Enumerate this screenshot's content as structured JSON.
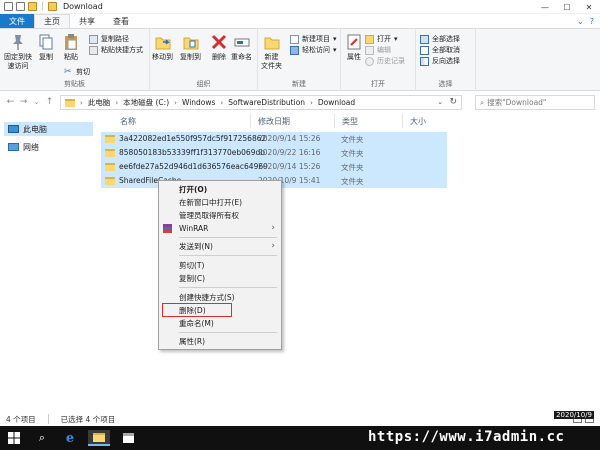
{
  "window": {
    "title": "Download",
    "controls": {
      "minimize": "—",
      "maximize": "☐",
      "close": "✕"
    }
  },
  "tabs": {
    "file": "文件",
    "home": "主页",
    "share": "共享",
    "view": "查看"
  },
  "ribbon": {
    "clipboard": {
      "label": "剪贴板",
      "pin": "固定到快\n速访问",
      "copy": "复制",
      "paste": "粘贴",
      "copy_path": "复制路径",
      "paste_shortcut": "粘贴快捷方式",
      "cut": "剪切"
    },
    "organize": {
      "label": "组织",
      "move_to": "移动到",
      "copy_to": "复制到",
      "delete": "删除",
      "rename": "重命名"
    },
    "new": {
      "label": "新建",
      "new_folder": "新建\n文件夹",
      "new_item": "新建项目",
      "easy_access": "轻松访问"
    },
    "open": {
      "label": "打开",
      "properties": "属性",
      "open": "打开",
      "edit": "编辑",
      "history": "历史记录"
    },
    "select": {
      "label": "选择",
      "select_all": "全部选择",
      "select_none": "全部取消",
      "invert": "反向选择"
    }
  },
  "address": {
    "crumbs": [
      "此电脑",
      "本地磁盘 (C:)",
      "Windows",
      "SoftwareDistribution",
      "Download"
    ],
    "search_placeholder": "搜索\"Download\""
  },
  "nav": {
    "this_pc": "此电脑",
    "network": "网络"
  },
  "columns": {
    "name": "名称",
    "date": "修改日期",
    "type": "类型",
    "size": "大小"
  },
  "files": [
    {
      "name": "3a422082ed1e550f957dc5f917256862",
      "date": "2020/9/14 15:26",
      "type": "文件夹"
    },
    {
      "name": "858050183b53339ff1f313770eb069db",
      "date": "2020/9/22 16:16",
      "type": "文件夹"
    },
    {
      "name": "ee6fde27a52d946d1d636576eac64969",
      "date": "2020/9/14 15:26",
      "type": "文件夹"
    },
    {
      "name": "SharedFileCache",
      "date": "2020/10/9 15:41",
      "type": "文件夹"
    }
  ],
  "context_menu": {
    "open": "打开(O)",
    "open_new_window": "在新窗口中打开(E)",
    "take_ownership": "管理员取得所有权",
    "winrar": "WinRAR",
    "send_to": "发送到(N)",
    "cut": "剪切(T)",
    "copy": "复制(C)",
    "create_shortcut": "创建快捷方式(S)",
    "delete": "删除(D)",
    "rename": "重命名(M)",
    "properties": "属性(R)"
  },
  "status": {
    "item_count": "4 个项目",
    "selected": "已选择 4 个项目"
  },
  "taskbar": {
    "watermark": "https://www.i7admin.cc",
    "date": "2020/10/9"
  },
  "colors": {
    "accent": "#1979ca",
    "selection": "#cce8ff",
    "highlight_box": "#e02b2b"
  }
}
